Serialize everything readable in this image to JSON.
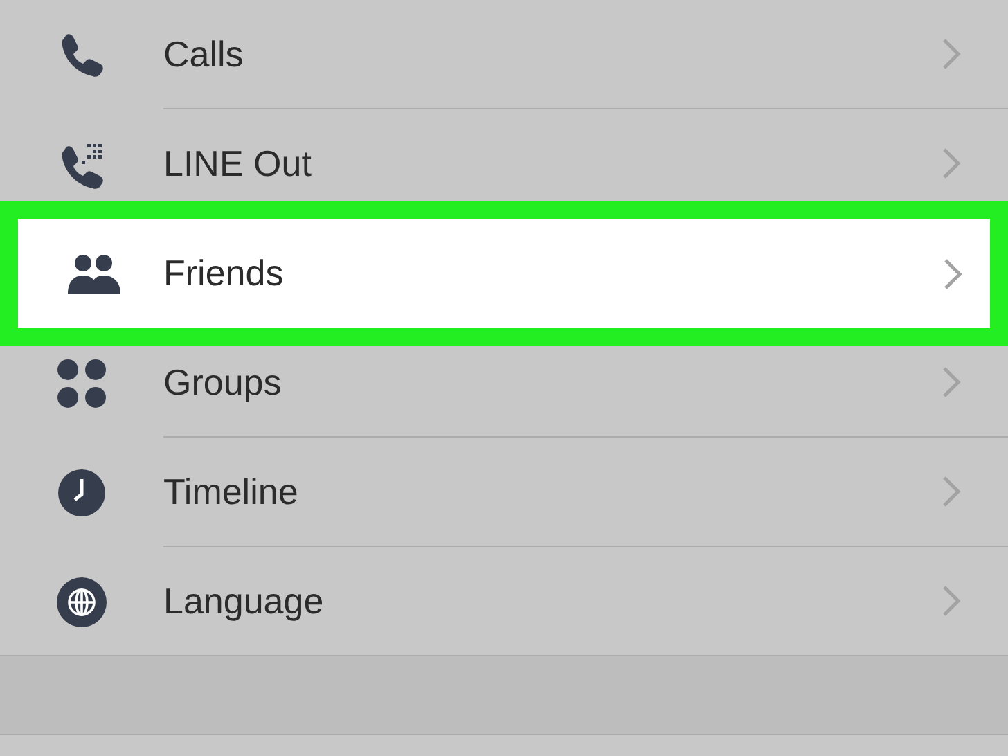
{
  "menu": [
    {
      "label": "Calls",
      "selected": false
    },
    {
      "label": "LINE Out",
      "selected": false
    },
    {
      "label": "Friends",
      "selected": true
    },
    {
      "label": "Groups",
      "selected": false
    },
    {
      "label": "Timeline",
      "selected": false
    },
    {
      "label": "Language",
      "selected": false
    }
  ]
}
